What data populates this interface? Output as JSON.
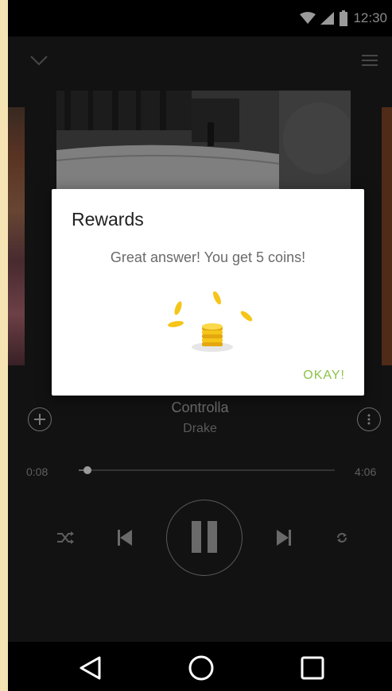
{
  "status_bar": {
    "time": "12:30",
    "icons": [
      "wifi-icon",
      "signal-icon",
      "battery-icon"
    ]
  },
  "player": {
    "collapse_icon": "chevron-down-icon",
    "menu_icon": "menu-icon",
    "track_title": "Controlla",
    "track_artist": "Drake",
    "elapsed": "0:08",
    "duration": "4:06",
    "progress_fraction": 0.033,
    "add_icon": "plus-circle-icon",
    "more_icon": "more-vertical-icon",
    "controls": [
      "shuffle-icon",
      "skip-previous-icon",
      "pause-icon",
      "skip-next-icon",
      "repeat-icon"
    ]
  },
  "dialog": {
    "title": "Rewards",
    "message": "Great answer! You get 5 coins!",
    "action_label": "OKAY!",
    "illustration": "coins-icon"
  },
  "nav_bar": {
    "buttons": [
      "back-icon",
      "home-icon",
      "recents-icon"
    ]
  },
  "colors": {
    "accent_green": "#8bc34a",
    "coin_gold": "#f5c518",
    "background_outer": "#f5e3b4"
  }
}
